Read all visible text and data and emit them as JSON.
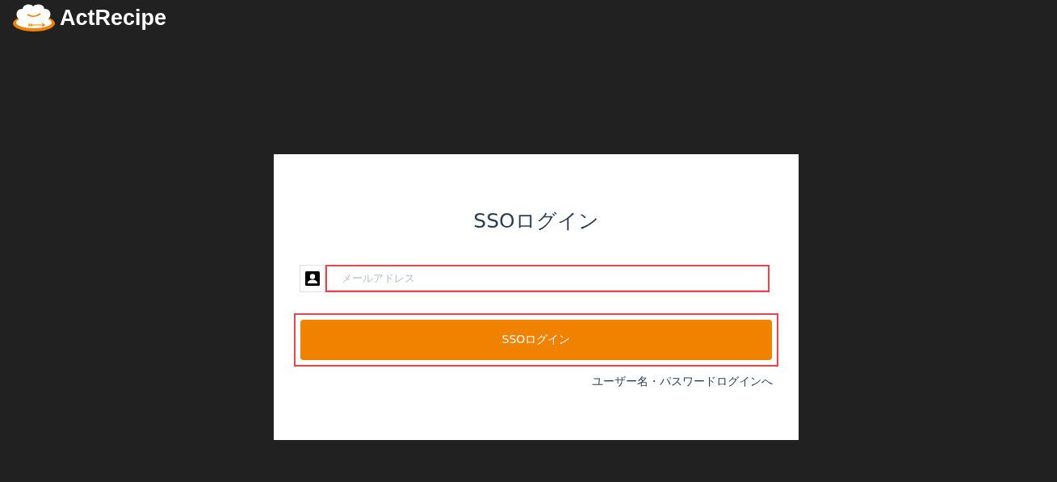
{
  "header": {
    "logo_text": "ActRecipe"
  },
  "card": {
    "title": "SSOログイン",
    "email_field": {
      "placeholder": "メールアドレス",
      "highlighted": true
    },
    "submit_button": {
      "label": "SSOログイン",
      "highlighted": true
    },
    "alt_login_link": "ユーザー名・パスワードログインへ"
  }
}
